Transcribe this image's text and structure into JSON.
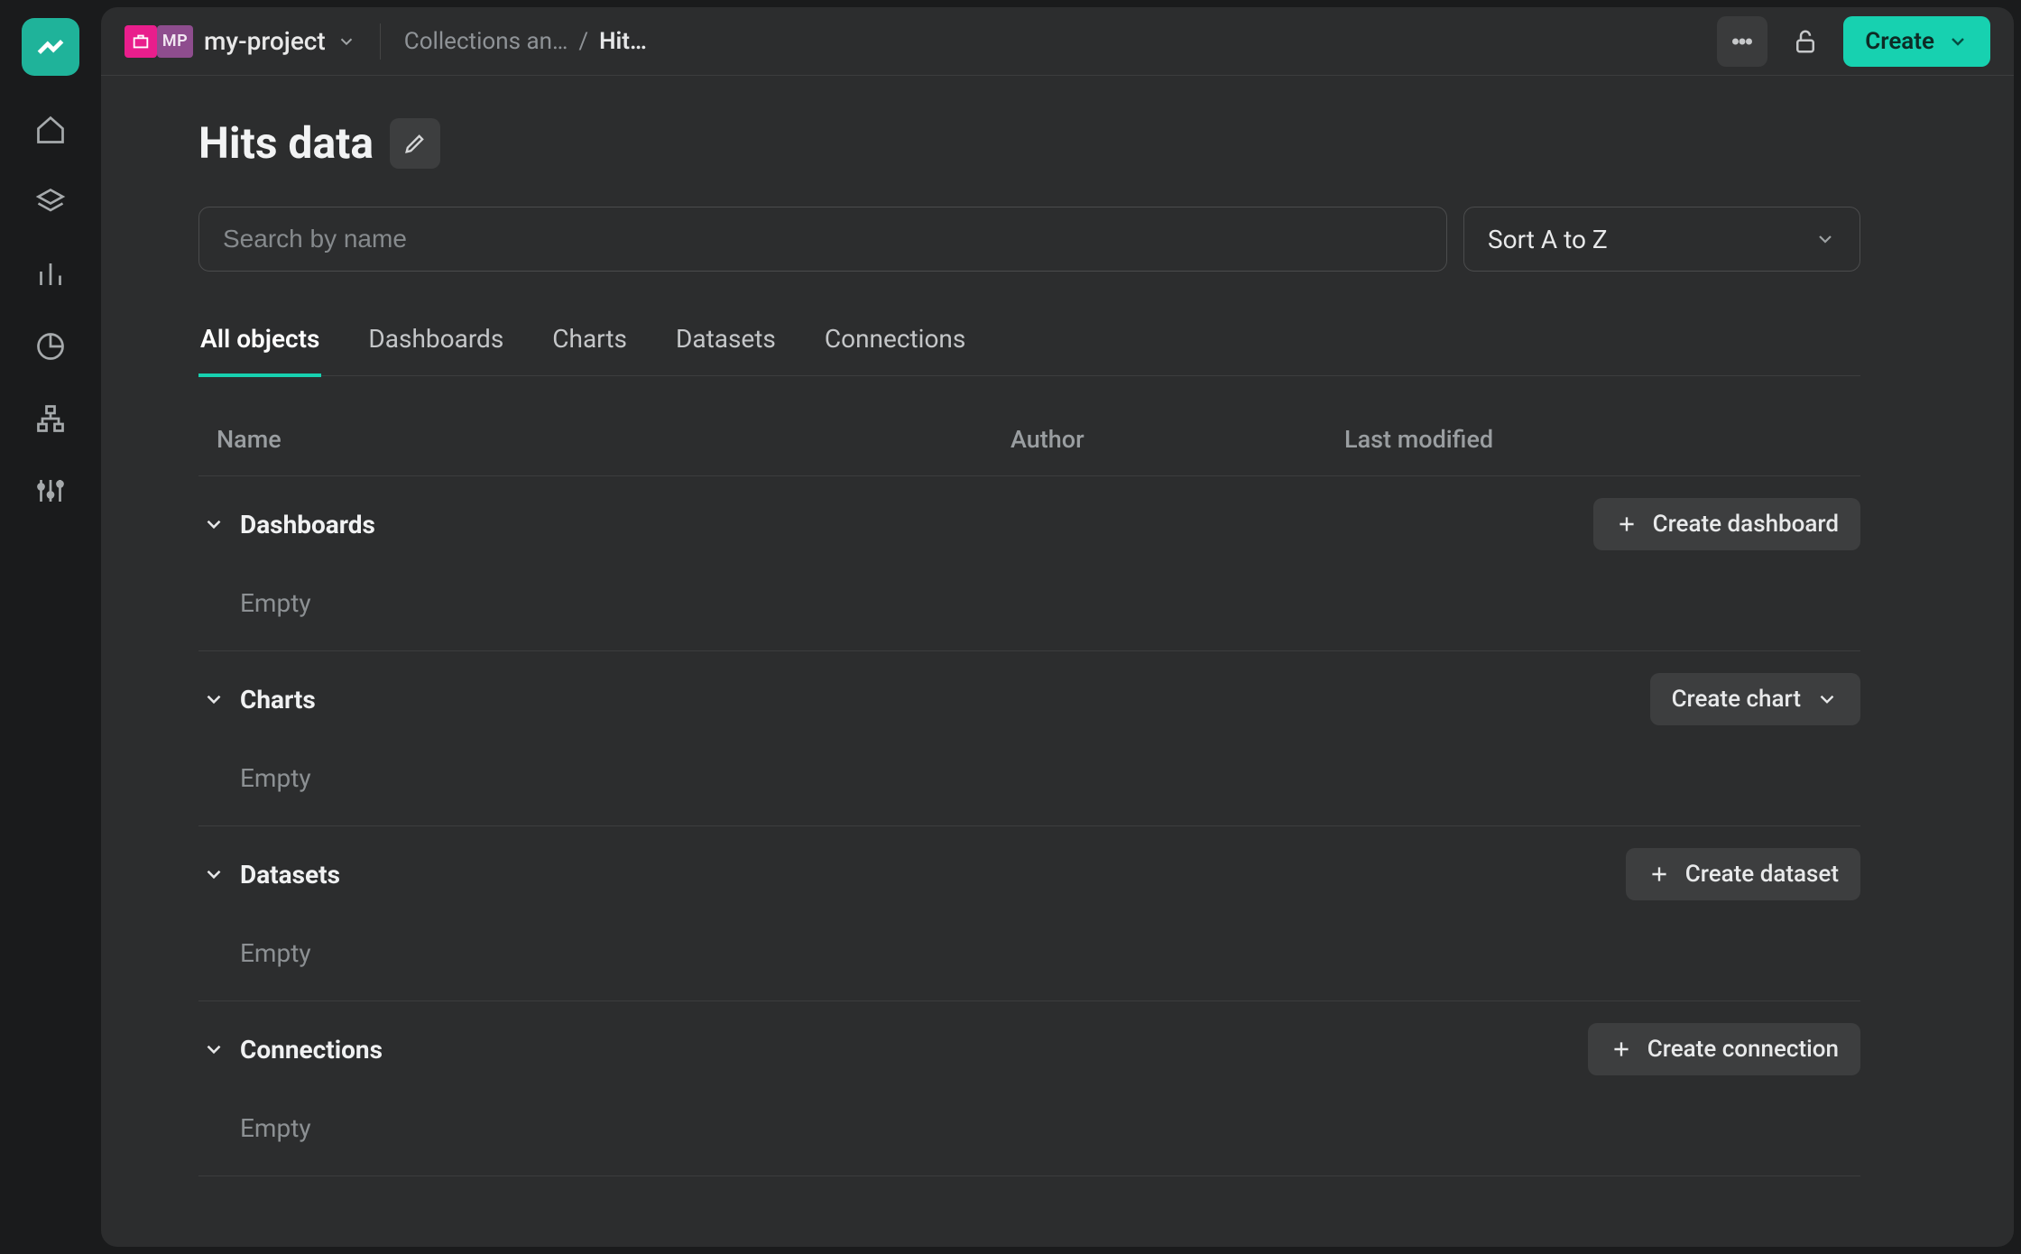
{
  "project": {
    "name": "my-project",
    "badge": "MP"
  },
  "breadcrumb": {
    "root": "Collections an…",
    "sep": "/",
    "leaf": "Hit…"
  },
  "header": {
    "create": "Create"
  },
  "page": {
    "title": "Hits data"
  },
  "search": {
    "placeholder": "Search by name"
  },
  "sort": {
    "label": "Sort A to Z"
  },
  "tabs": {
    "all": "All objects",
    "dashboards": "Dashboards",
    "charts": "Charts",
    "datasets": "Datasets",
    "connections": "Connections"
  },
  "columns": {
    "name": "Name",
    "author": "Author",
    "modified": "Last modified"
  },
  "sections": {
    "dashboards": {
      "title": "Dashboards",
      "action": "Create dashboard",
      "empty": "Empty"
    },
    "charts": {
      "title": "Charts",
      "action": "Create chart",
      "empty": "Empty"
    },
    "datasets": {
      "title": "Datasets",
      "action": "Create dataset",
      "empty": "Empty"
    },
    "connections": {
      "title": "Connections",
      "action": "Create connection",
      "empty": "Empty"
    }
  }
}
